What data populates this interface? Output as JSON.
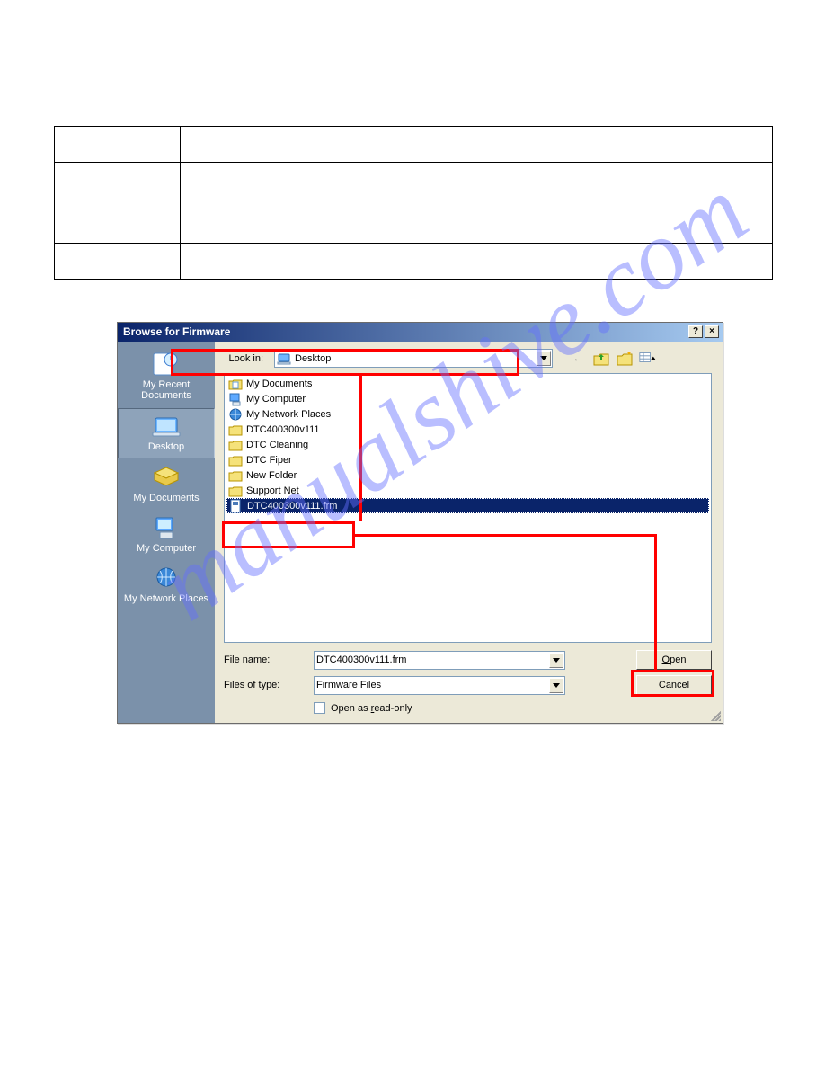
{
  "watermark": "manualshive.com",
  "dialog": {
    "title": "Browse for Firmware",
    "lookin_label": "Look in:",
    "lookin_value": "Desktop",
    "file_list": [
      {
        "name": "My Documents",
        "type": "mydocs"
      },
      {
        "name": "My Computer",
        "type": "mycomp"
      },
      {
        "name": "My Network Places",
        "type": "mynet"
      },
      {
        "name": "DTC400300v111",
        "type": "folder"
      },
      {
        "name": "DTC Cleaning",
        "type": "folder"
      },
      {
        "name": "DTC Fiper",
        "type": "folder"
      },
      {
        "name": "New Folder",
        "type": "folder"
      },
      {
        "name": "Support Net",
        "type": "folder"
      },
      {
        "name": "DTC400300v111.frm",
        "type": "file",
        "selected": true
      }
    ],
    "file_name_label": "File name:",
    "file_name_value": "DTC400300v111.frm",
    "files_of_type_label": "Files of type:",
    "files_of_type_value": "Firmware Files",
    "readonly_label": "Open as read-only",
    "open_label": "Open",
    "cancel_label": "Cancel",
    "help_glyph": "?",
    "close_glyph": "×"
  },
  "sidebar": {
    "items": [
      {
        "label": "My Recent Documents"
      },
      {
        "label": "Desktop"
      },
      {
        "label": "My Documents"
      },
      {
        "label": "My Computer"
      },
      {
        "label": "My Network Places"
      }
    ]
  },
  "nav_icons": {
    "back": "←",
    "up": "folder-up",
    "new": "folder-new",
    "views": "views"
  }
}
